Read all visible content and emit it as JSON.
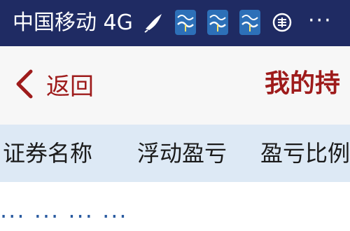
{
  "status_bar": {
    "carrier": "中国移动 4G",
    "more": "···",
    "icons": [
      "bird-icon",
      "app-wave-icon",
      "app-wave-icon",
      "app-wave-icon",
      "bank-icon"
    ]
  },
  "header": {
    "back_label": "返回",
    "title": "我的持"
  },
  "columns": {
    "name": "证券名称",
    "floating_pl": "浮动盈亏",
    "pl_ratio": "盈亏比例"
  },
  "row": {
    "partial_text": "··· ··· ··· ···"
  },
  "colors": {
    "status_bar_bg": "#1f2b63",
    "accent_red": "#9e1b1b",
    "column_bar_bg": "#dde9f5"
  }
}
